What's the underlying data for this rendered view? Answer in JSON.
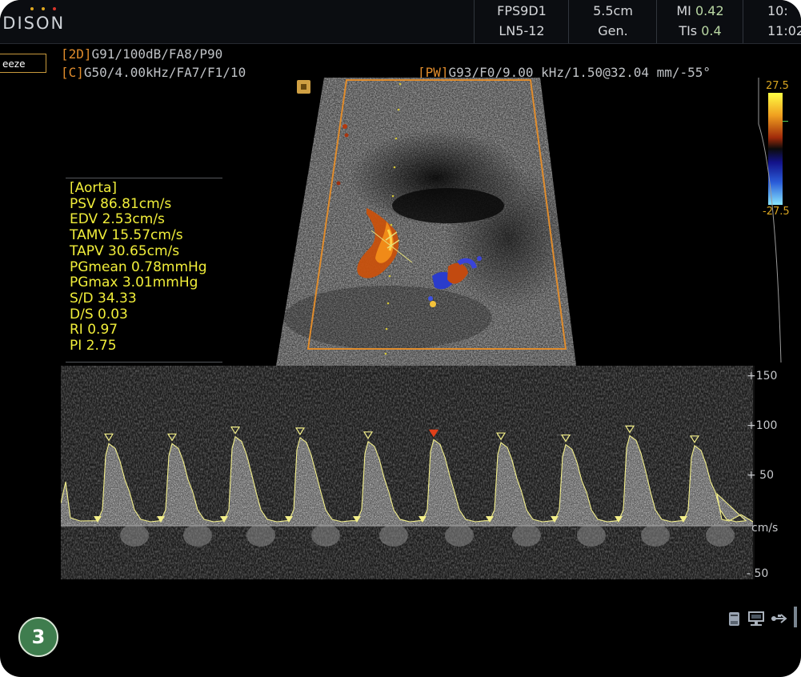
{
  "header": {
    "brand": "EDISON",
    "brand_dot_colors": [
      "#e0a820",
      "#e0a820",
      "#d8352a"
    ],
    "probe_preset": "FPS9D1",
    "probe_model": "LN5-12",
    "depth": "5.5cm",
    "application": "Gen.",
    "mi_label": "MI",
    "mi_value": "0.42",
    "tis_label": "TIs",
    "tis_value": "0.4",
    "time_top": "10:",
    "time": "11:02"
  },
  "freeze_label": "eeze",
  "params": {
    "mode_2d_tag": "[2D]",
    "mode_2d": "G91/100dB/FA8/P90",
    "mode_c_tag": "[C]",
    "mode_c": "G50/4.00kHz/FA7/F1/10",
    "mode_pw_tag": "[PW]",
    "mode_pw": "G93/F0/9.00 kHz/1.50@32.04 mm/-55°"
  },
  "color_bar": {
    "max_label": "27.5",
    "min_label": "-27.5"
  },
  "measurements": [
    "[Aorta]",
    "PSV 86.81cm/s",
    "EDV 2.53cm/s",
    "TAMV 15.57cm/s",
    "TAPV 30.65cm/s",
    "PGmean 0.78mmHg",
    "PGmax 3.01mmHg",
    "S/D 34.33",
    "D/S 0.03",
    "RI  0.97",
    "PI  2.75"
  ],
  "doppler_scale": {
    "s150": "+150",
    "s100": "+100",
    "s50": "+ 50",
    "unit": "cm/s",
    "sneg50": "- 50"
  },
  "doppler_cycles": {
    "count": 10,
    "peak_velocity": 86.81,
    "end_diastolic_velocity": 2.53
  },
  "badge": "3",
  "colors": {
    "accent_orange": "#e08c2c",
    "measurement_yellow": "#f1ee3a",
    "trace": "#f3ef8a",
    "badge_green": "#3f7d4e"
  },
  "status_icons": [
    "storage-icon",
    "network-icon",
    "usb-icon"
  ]
}
